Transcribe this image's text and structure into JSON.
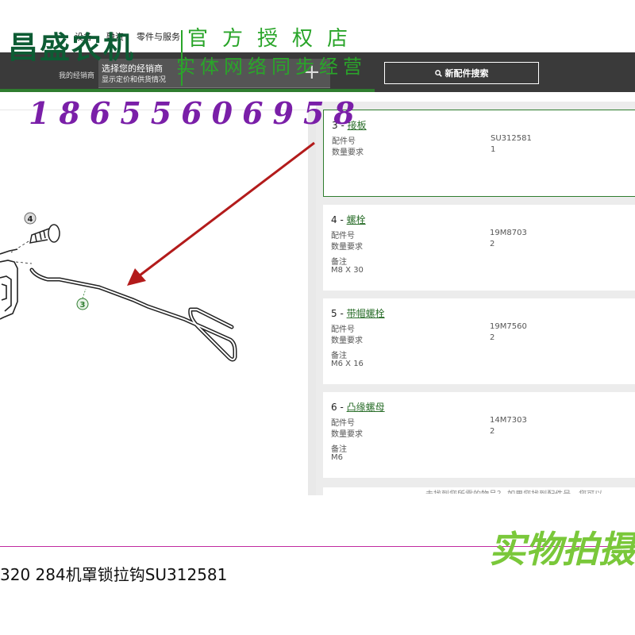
{
  "nav": {
    "links": [
      "设备",
      "融资",
      "零件与服务"
    ],
    "dealer_label": "我的经销商",
    "dealer_title": "选择您的经销商",
    "dealer_subtitle": "显示定价和供货情况",
    "dealer_plus": "+",
    "search_label": "新配件搜索"
  },
  "watermark": {
    "logo": "昌盛农机",
    "shop": "官方授权店",
    "sync": "实体网络同步经营",
    "phone": "18655606958",
    "real": "实物拍摄"
  },
  "diagram": {
    "callouts": [
      "4",
      "3"
    ]
  },
  "parts": [
    {
      "num": "3",
      "name": "接板",
      "part_label": "配件号",
      "part_no": "SU312581",
      "qty_label": "数量要求",
      "qty": "1",
      "remark_label": "",
      "remark": ""
    },
    {
      "num": "4",
      "name": "螺栓",
      "part_label": "配件号",
      "part_no": "19M8703",
      "qty_label": "数量要求",
      "qty": "2",
      "remark_label": "备注",
      "remark": "M8 X 30"
    },
    {
      "num": "5",
      "name": "带帽螺栓",
      "part_label": "配件号",
      "part_no": "19M7560",
      "qty_label": "数量要求",
      "qty": "2",
      "remark_label": "备注",
      "remark": "M6 X 16"
    },
    {
      "num": "6",
      "name": "凸缘螺母",
      "part_label": "配件号",
      "part_no": "14M7303",
      "qty_label": "数量要求",
      "qty": "2",
      "remark_label": "备注",
      "remark": "M6"
    }
  ],
  "cut_text": "未找到您所需的物品？ 如果您找到配件号，您可以",
  "caption": "320 284机罩锁拉钩SU312581",
  "colors": {
    "nav_dark": "#3a3a3a",
    "brand_green": "#2f7d2f",
    "phone_purple": "#7a1fa8",
    "arrow_red": "#b31b1b"
  }
}
